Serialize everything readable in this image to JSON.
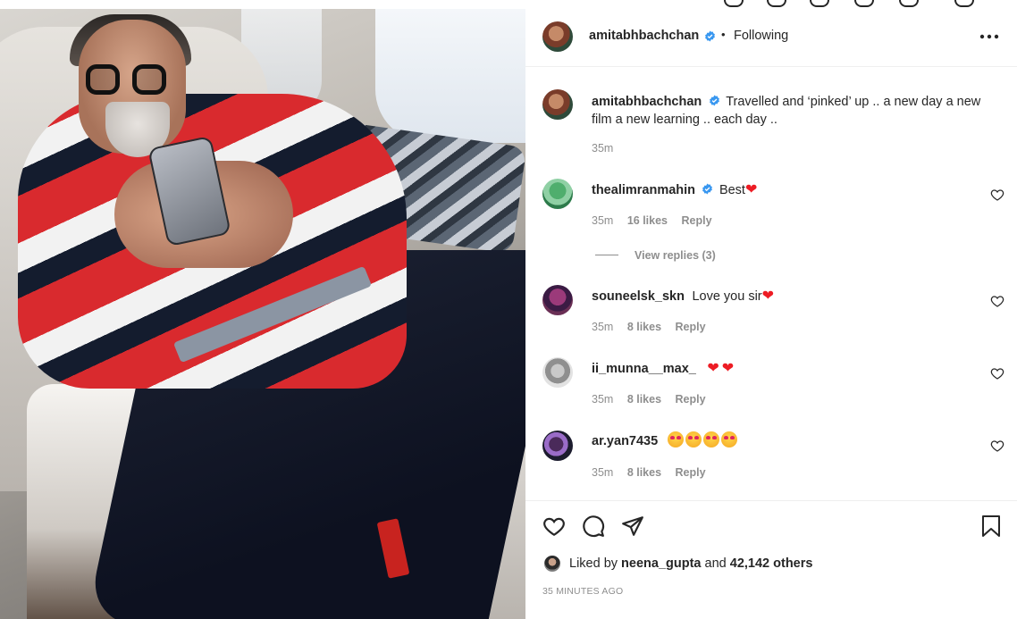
{
  "post": {
    "author": "amitabhbachchan",
    "follow_status": "Following",
    "bullet": "•",
    "more_menu": "more-horizontal-icon",
    "caption": "Travelled and ‘pinked’ up .. a new day a new film a new learning .. each day ..",
    "caption_line1": "Travelled and ‘pinked’ up .. a new day a new",
    "caption_line2": "film a new learning .. each day ..",
    "caption_time": "35m"
  },
  "comments": [
    {
      "user": "thealimranmahin",
      "verified": true,
      "text": "Best",
      "emoji": "red-heart",
      "time": "35m",
      "likes": "16 likes",
      "reply": "Reply",
      "view_replies": "View replies (3)"
    },
    {
      "user": "souneelsk_skn",
      "verified": false,
      "text": "Love you sir",
      "emoji": "red-heart",
      "time": "35m",
      "likes": "8 likes",
      "reply": "Reply"
    },
    {
      "user": "ii_munna__max_",
      "verified": false,
      "text": "",
      "emoji": "red-heart x2",
      "time": "35m",
      "likes": "8 likes",
      "reply": "Reply"
    },
    {
      "user": "ar.yan7435",
      "verified": false,
      "text": "",
      "emoji": "star-struck x4",
      "time": "35m",
      "likes": "8 likes",
      "reply": "Reply"
    }
  ],
  "actions": {
    "like": "heart-icon",
    "comment": "comment-icon",
    "share": "share-icon",
    "save": "bookmark-icon"
  },
  "likes": {
    "prefix": "Liked by",
    "user": "neena_gupta",
    "and": "and",
    "others": "42,142 others",
    "timestamp": "35 MINUTES AGO"
  },
  "colors": {
    "verified": "#3897f0",
    "text": "#262626",
    "muted": "#8e8e8e",
    "heart": "#ed1c24"
  }
}
